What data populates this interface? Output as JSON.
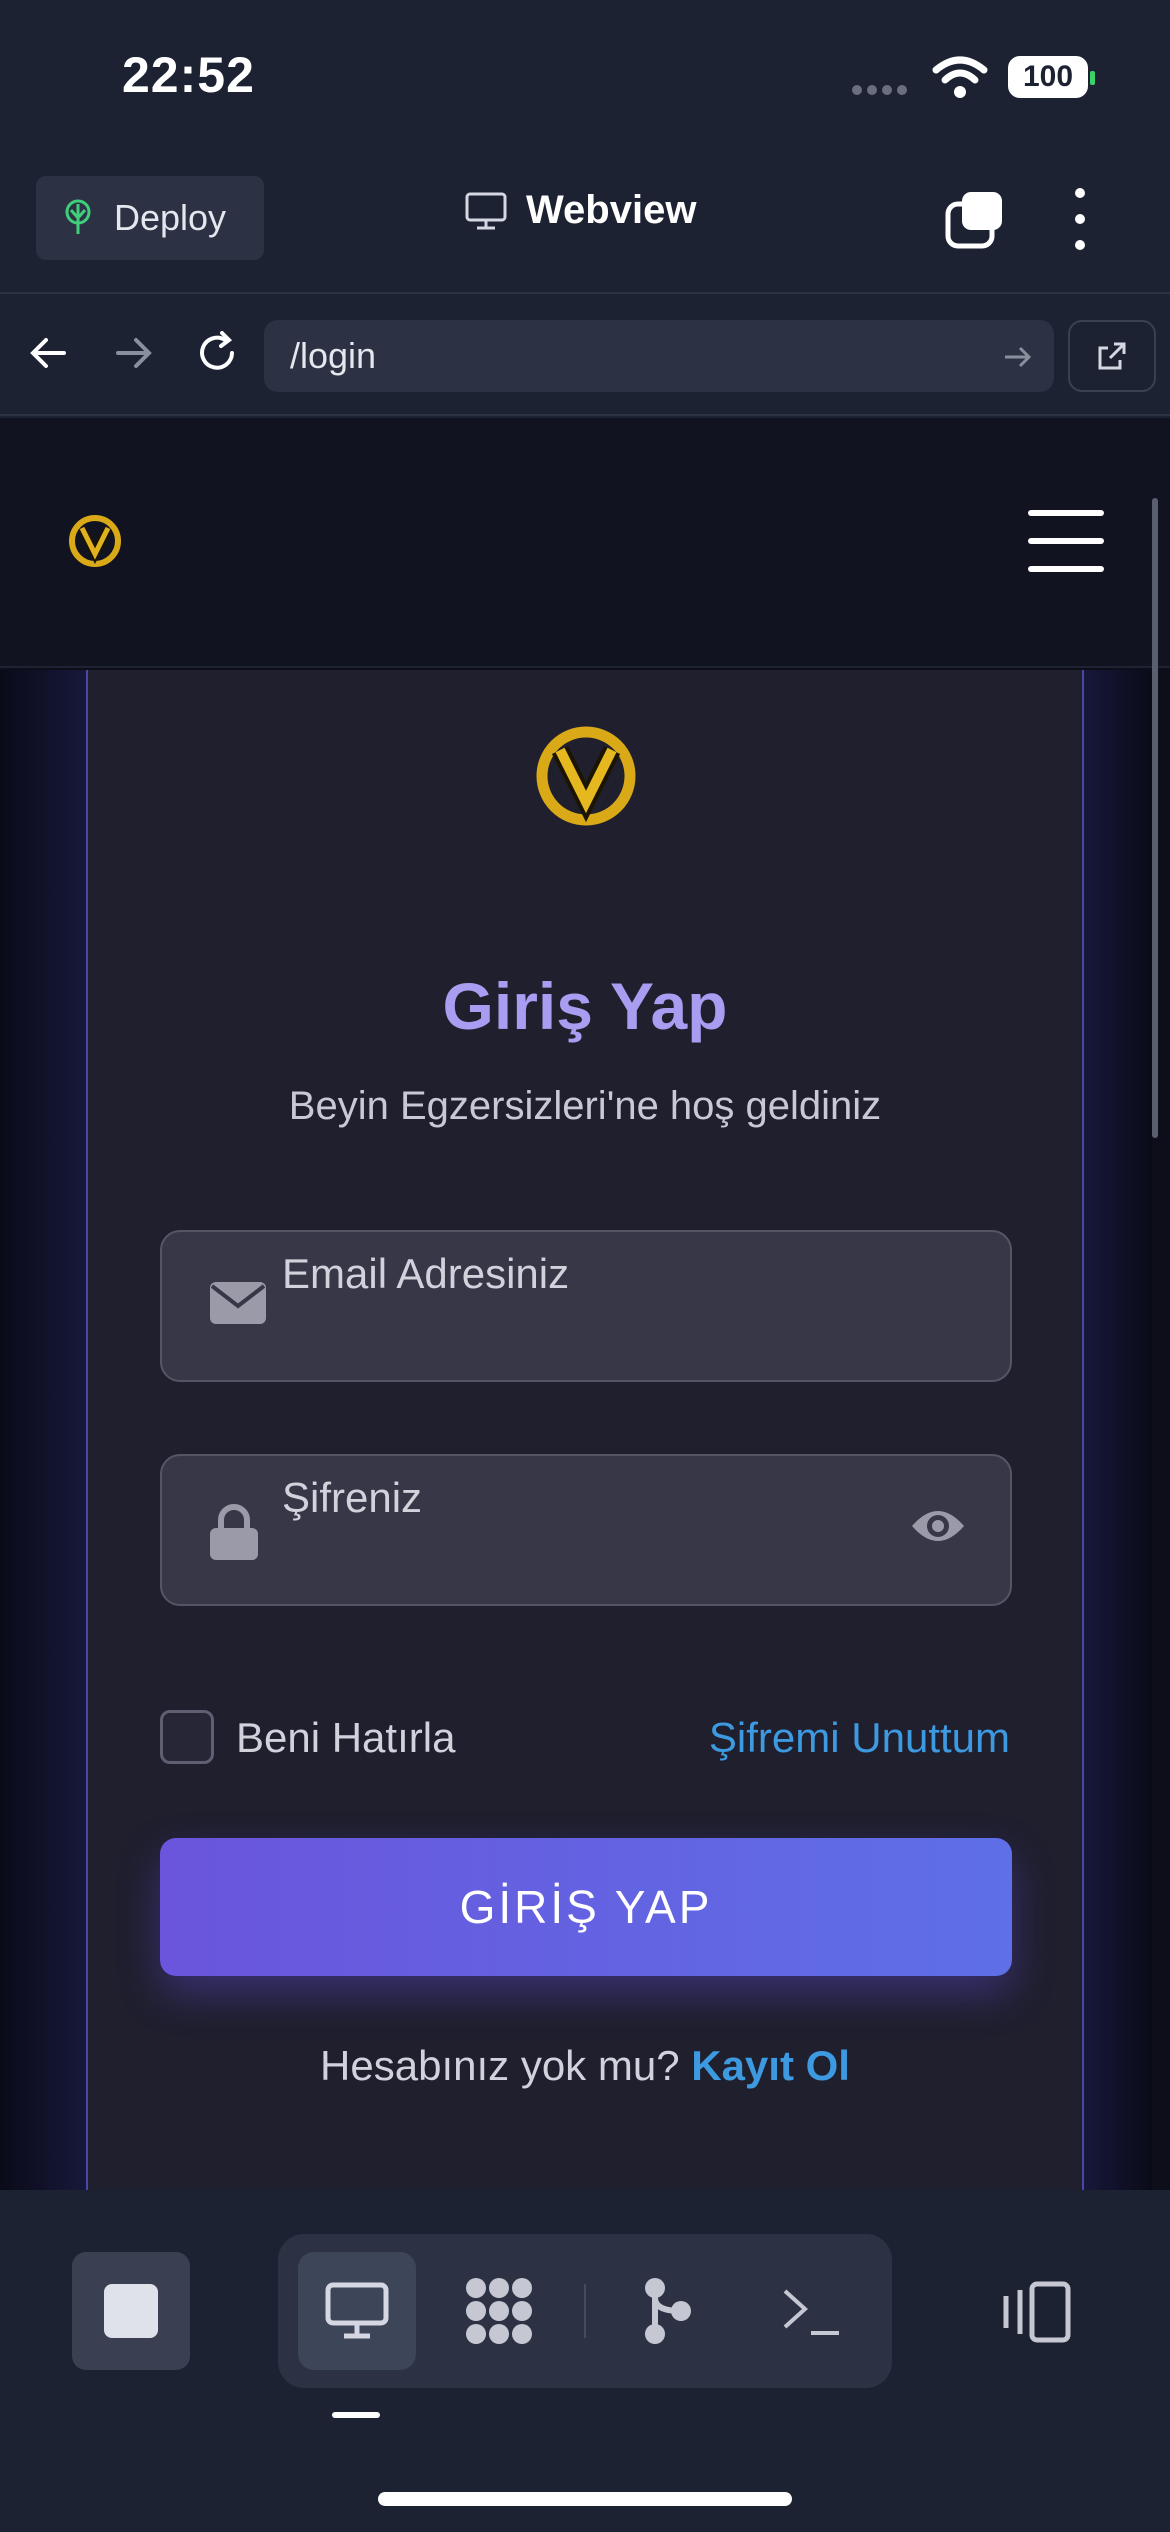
{
  "status_bar": {
    "time": "22:52",
    "battery": "100"
  },
  "header": {
    "deploy_label": "Deploy",
    "title": "Webview"
  },
  "url_bar": {
    "url": "/login"
  },
  "login": {
    "title": "Giriş Yap",
    "subtitle": "Beyin Egzersizleri'ne hoş geldiniz",
    "email_label": "Email Adresiniz",
    "password_label": "Şifreniz",
    "remember_label": "Beni Hatırla",
    "forgot_label": "Şifremi Unuttum",
    "submit_label": "GİRİŞ YAP",
    "register_prompt": "Hesabınız yok mu?",
    "register_link": "Kayıt Ol"
  },
  "colors": {
    "background": "#1d2233",
    "accent_purple": "#6a55dc",
    "accent_blue": "#3d9ae0",
    "logo_gold": "#d9a918"
  },
  "icons": {
    "nav": [
      "back-icon",
      "forward-icon",
      "reload-icon"
    ],
    "toolbar": [
      "stop-icon",
      "monitor-icon",
      "packages-icon",
      "git-icon",
      "terminal-icon",
      "side-panel-icon"
    ]
  }
}
